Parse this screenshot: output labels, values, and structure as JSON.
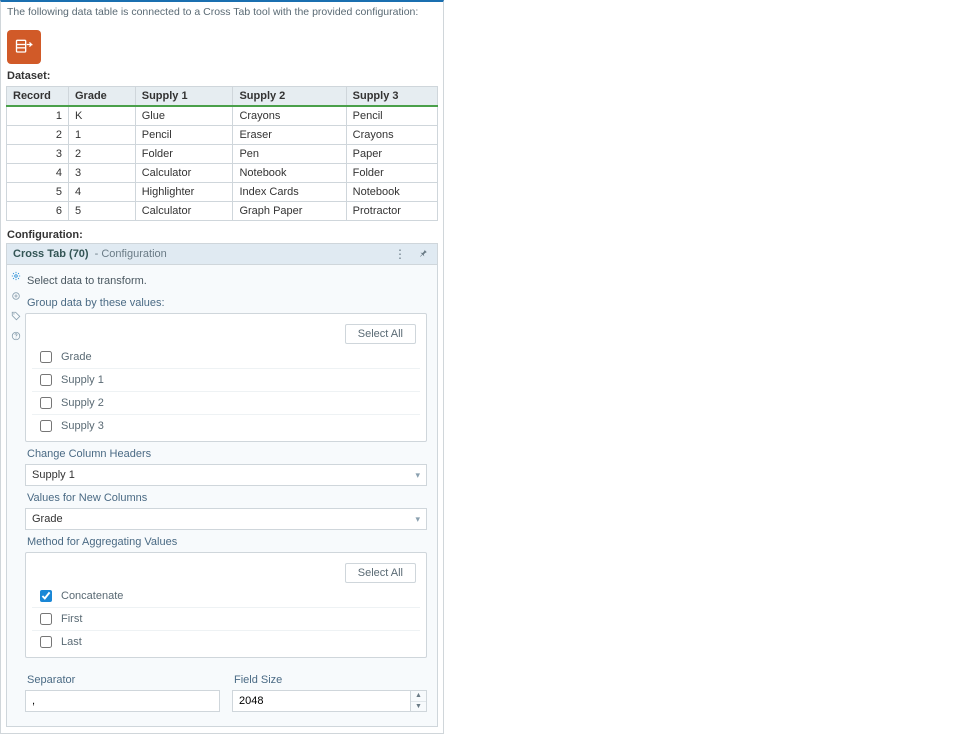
{
  "intro": "The following data table is connected to a Cross Tab tool with the provided configuration:",
  "labels": {
    "dataset": "Dataset:",
    "configuration": "Configuration:"
  },
  "table": {
    "headers": [
      "Record",
      "Grade",
      "Supply 1",
      "Supply 2",
      "Supply 3"
    ],
    "rows": [
      [
        "1",
        "K",
        "Glue",
        "Crayons",
        "Pencil"
      ],
      [
        "2",
        "1",
        "Pencil",
        "Eraser",
        "Crayons"
      ],
      [
        "3",
        "2",
        "Folder",
        "Pen",
        "Paper"
      ],
      [
        "4",
        "3",
        "Calculator",
        "Notebook",
        "Folder"
      ],
      [
        "5",
        "4",
        "Highlighter",
        "Index Cards",
        "Notebook"
      ],
      [
        "6",
        "5",
        "Calculator",
        "Graph Paper",
        "Protractor"
      ]
    ]
  },
  "config": {
    "panel_title": "Cross Tab (70)",
    "panel_sub": " - Configuration",
    "instruction": "Select data to transform.",
    "group_label": "Group data by these values:",
    "select_all": "Select All",
    "group_options": [
      "Grade",
      "Supply 1",
      "Supply 2",
      "Supply 3"
    ],
    "change_headers_label": "Change Column Headers",
    "change_headers_value": "Supply 1",
    "values_new_label": "Values for New Columns",
    "values_new_value": "Grade",
    "aggregate_label": "Method for Aggregating Values",
    "aggregate_options": [
      {
        "label": "Concatenate",
        "checked": true
      },
      {
        "label": "First",
        "checked": false
      },
      {
        "label": "Last",
        "checked": false
      }
    ],
    "separator_label": "Separator",
    "separator_value": ",",
    "field_size_label": "Field Size",
    "field_size_value": "2048"
  }
}
